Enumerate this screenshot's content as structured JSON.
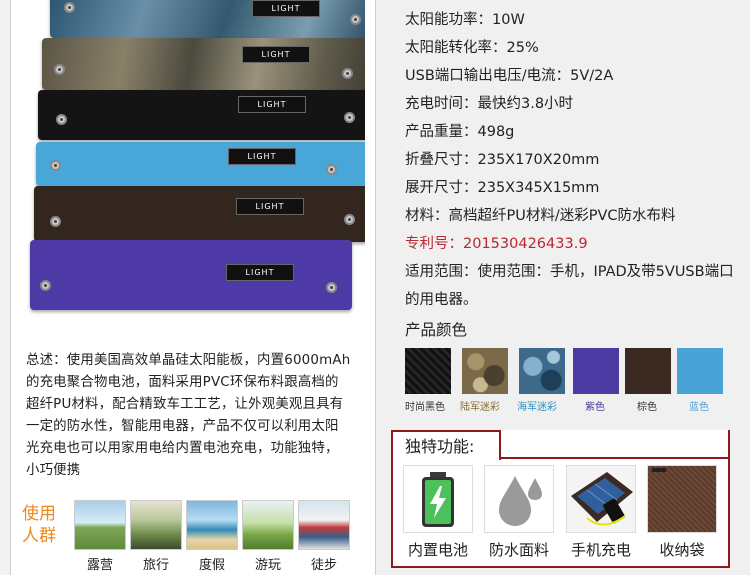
{
  "product_image": {
    "tag_text": "LIGHT",
    "panels": [
      "blue-camo",
      "gray-camo",
      "black",
      "sky-blue",
      "dark-brown",
      "purple"
    ]
  },
  "summary": {
    "text": "总述：使用美国高效单晶硅太阳能板，内置6000mAh的充电聚合物电池，面料采用PVC环保布料跟高档的超纤PU材料，配合精致车工工艺，让外观美观且具有一定的防水性，智能用电器，产品不仅可以利用太阳光充电也可以用家用电给内置电池充电，功能独特，小巧便携"
  },
  "usage": {
    "label": "使用人群",
    "items": [
      "露营",
      "旅行",
      "度假",
      "游玩",
      "徒步"
    ]
  },
  "specs": [
    "太阳能功率：10W",
    "太阳能转化率：25%",
    "USB端口输出电压/电流：5V/2A",
    "充电时间：最快约3.8小时",
    "产品重量：498g",
    "折叠尺寸：235X170X20mm",
    "展开尺寸：235X345X15mm",
    "材料：高档超纤PU材料/迷彩PVC防水布料",
    "专利号：201530426433.9",
    "适用范围：使用范围：手机，IPAD及带5VUSB端口的用电器。"
  ],
  "colors_section": {
    "title": "产品颜色",
    "swatches": [
      {
        "label": "时尚黑色",
        "color": "#1b1b1b",
        "label_color": "#333333"
      },
      {
        "label": "陆军迷彩",
        "color": "#7a6a4a",
        "label_color": "#8a6d2e"
      },
      {
        "label": "海军迷彩",
        "color": "#3d6a8a",
        "label_color": "#2a8fc1"
      },
      {
        "label": "紫色",
        "color": "#4c3aa3",
        "label_color": "#4c3aa3"
      },
      {
        "label": "棕色",
        "color": "#3a2a22",
        "label_color": "#333333"
      },
      {
        "label": "蓝色",
        "color": "#4aa3d6",
        "label_color": "#4aa3d6"
      }
    ]
  },
  "features": {
    "title": "独特功能:",
    "items": [
      "内置电池",
      "防水面料",
      "手机充电",
      "收纳袋"
    ]
  },
  "colors": {
    "accent_red": "#8b1a1a",
    "usage_orange": "#e98a1f"
  }
}
